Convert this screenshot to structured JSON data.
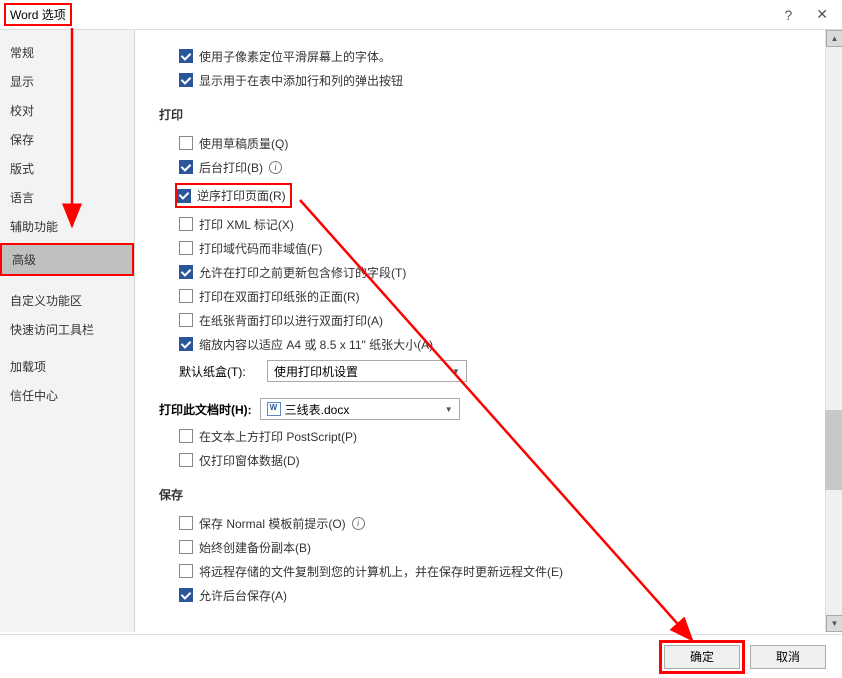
{
  "titlebar": {
    "title": "Word 选项"
  },
  "sidebar": {
    "items": [
      {
        "label": "常规"
      },
      {
        "label": "显示"
      },
      {
        "label": "校对"
      },
      {
        "label": "保存"
      },
      {
        "label": "版式"
      },
      {
        "label": "语言"
      },
      {
        "label": "辅助功能"
      },
      {
        "label": "高级"
      },
      {
        "label": "自定义功能区"
      },
      {
        "label": "快速访问工具栏"
      },
      {
        "label": "加载项"
      },
      {
        "label": "信任中心"
      }
    ]
  },
  "topChecks": {
    "subpixel": "使用子像素定位平滑屏幕上的字体。",
    "popupBtn": "显示用于在表中添加行和列的弹出按钮"
  },
  "sections": {
    "print": "打印",
    "save": "保存"
  },
  "print": {
    "draft": "使用草稿质量(Q)",
    "background": "后台打印(B)",
    "reverse": "逆序打印页面(R)",
    "xml": "打印 XML 标记(X)",
    "fieldCodes": "打印域代码而非域值(F)",
    "updateFields": "允许在打印之前更新包含修订的字段(T)",
    "frontDuplex": "打印在双面打印纸张的正面(R)",
    "backDuplex": "在纸张背面打印以进行双面打印(A)",
    "scaleA4": "缩放内容以适应 A4 或 8.5 x 11\" 纸张大小(A)",
    "trayLabel": "默认纸盒(T):",
    "trayValue": "使用打印机设置",
    "docLabel": "打印此文档时(H):",
    "docValue": "三线表.docx",
    "postscript": "在文本上方打印 PostScript(P)",
    "formsOnly": "仅打印窗体数据(D)"
  },
  "save": {
    "normalPrompt": "保存 Normal 模板前提示(O)",
    "backup": "始终创建备份副本(B)",
    "remoteCopy": "将远程存储的文件复制到您的计算机上，并在保存时更新远程文件(E)",
    "backgroundSave": "允许后台保存(A)"
  },
  "footer": {
    "ok": "确定",
    "cancel": "取消"
  }
}
